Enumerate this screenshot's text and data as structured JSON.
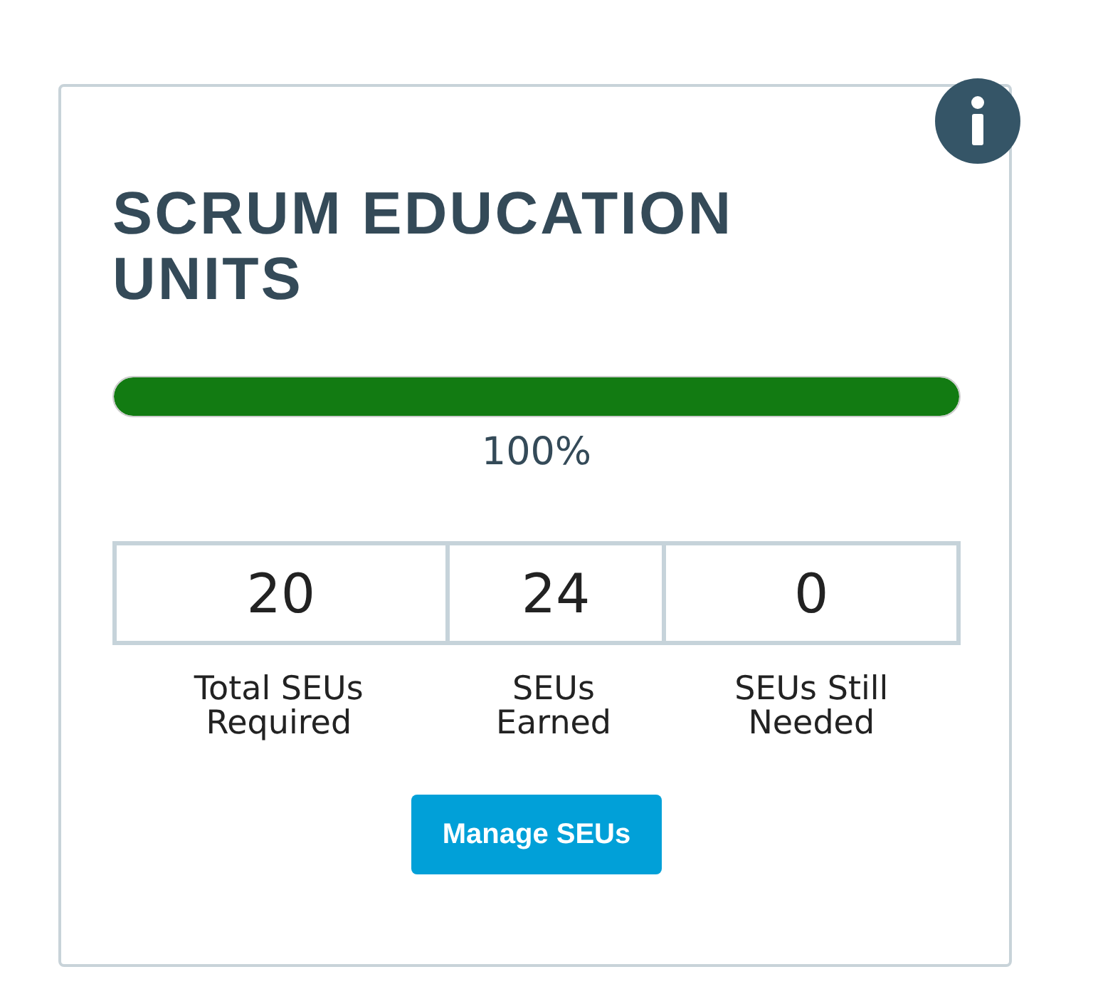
{
  "card": {
    "title": "SCRUM EDUCATION UNITS"
  },
  "progress": {
    "level": 1,
    "reading": "100%"
  },
  "stats": [
    {
      "value": "20",
      "label": "Total SEUs Required"
    },
    {
      "value": "24",
      "label": "SEUs Earned"
    },
    {
      "value": "0",
      "label": "SEUs Still Needed"
    }
  ],
  "button": {
    "label": "Manage SEUs"
  }
}
